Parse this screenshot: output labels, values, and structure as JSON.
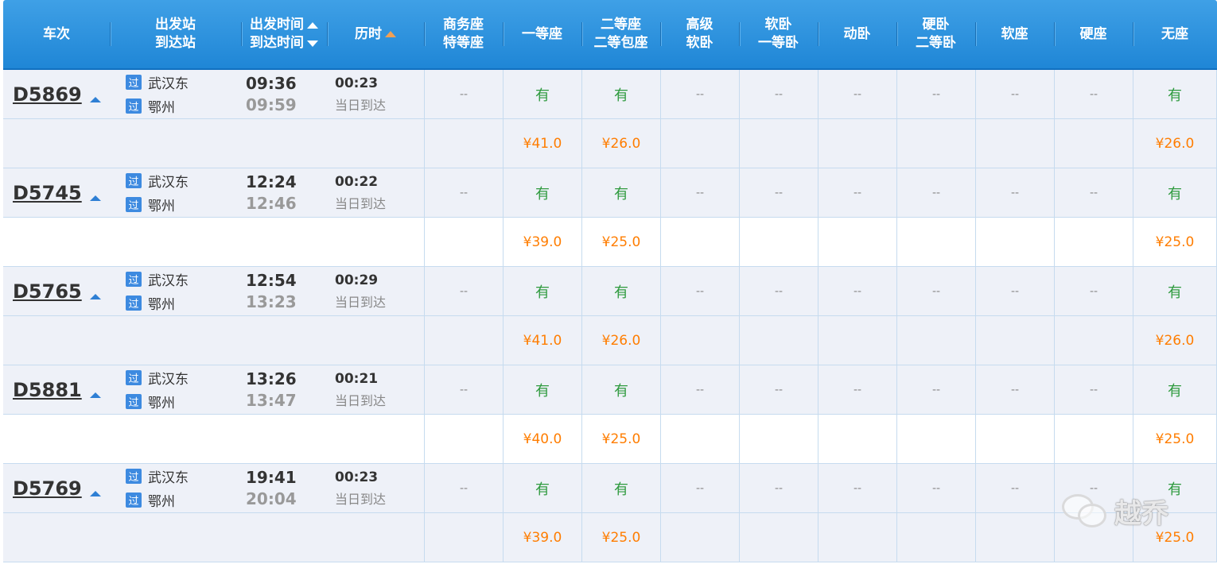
{
  "header": {
    "col_train": "车次",
    "col_from": "出发站",
    "col_to": "到达站",
    "col_dep_time": "出发时间",
    "col_arr_time": "到达时间",
    "col_duration": "历时",
    "col_business_1": "商务座",
    "col_business_2": "特等座",
    "col_first": "一等座",
    "col_second_1": "二等座",
    "col_second_2": "二等包座",
    "col_hsoft_1": "高级",
    "col_hsoft_2": "软卧",
    "col_soft_sleeper_1": "软卧",
    "col_soft_sleeper_2": "一等卧",
    "col_moving_sleeper": "动卧",
    "col_hard_sleeper_1": "硬卧",
    "col_hard_sleeper_2": "二等卧",
    "col_soft_seat": "软座",
    "col_hard_seat": "硬座",
    "col_no_seat": "无座"
  },
  "trains": [
    {
      "code": "D5869",
      "via_badge": "过",
      "from": "武汉东",
      "to": "鄂州",
      "dep": "09:36",
      "arr": "09:59",
      "duration": "00:23",
      "arrive_note": "当日到达",
      "seats": [
        "--",
        "有",
        "有",
        "--",
        "--",
        "--",
        "--",
        "--",
        "--",
        "有"
      ],
      "prices": [
        "",
        "¥41.0",
        "¥26.0",
        "",
        "",
        "",
        "",
        "",
        "",
        "¥26.0"
      ]
    },
    {
      "code": "D5745",
      "via_badge": "过",
      "from": "武汉东",
      "to": "鄂州",
      "dep": "12:24",
      "arr": "12:46",
      "duration": "00:22",
      "arrive_note": "当日到达",
      "seats": [
        "--",
        "有",
        "有",
        "--",
        "--",
        "--",
        "--",
        "--",
        "--",
        "有"
      ],
      "prices": [
        "",
        "¥39.0",
        "¥25.0",
        "",
        "",
        "",
        "",
        "",
        "",
        "¥25.0"
      ]
    },
    {
      "code": "D5765",
      "via_badge": "过",
      "from": "武汉东",
      "to": "鄂州",
      "dep": "12:54",
      "arr": "13:23",
      "duration": "00:29",
      "arrive_note": "当日到达",
      "seats": [
        "--",
        "有",
        "有",
        "--",
        "--",
        "--",
        "--",
        "--",
        "--",
        "有"
      ],
      "prices": [
        "",
        "¥41.0",
        "¥26.0",
        "",
        "",
        "",
        "",
        "",
        "",
        "¥26.0"
      ]
    },
    {
      "code": "D5881",
      "via_badge": "过",
      "from": "武汉东",
      "to": "鄂州",
      "dep": "13:26",
      "arr": "13:47",
      "duration": "00:21",
      "arrive_note": "当日到达",
      "seats": [
        "--",
        "有",
        "有",
        "--",
        "--",
        "--",
        "--",
        "--",
        "--",
        "有"
      ],
      "prices": [
        "",
        "¥40.0",
        "¥25.0",
        "",
        "",
        "",
        "",
        "",
        "",
        "¥25.0"
      ]
    },
    {
      "code": "D5769",
      "via_badge": "过",
      "from": "武汉东",
      "to": "鄂州",
      "dep": "19:41",
      "arr": "20:04",
      "duration": "00:23",
      "arrive_note": "当日到达",
      "seats": [
        "--",
        "有",
        "有",
        "--",
        "--",
        "--",
        "--",
        "--",
        "--",
        "有"
      ],
      "prices": [
        "",
        "¥39.0",
        "¥25.0",
        "",
        "",
        "",
        "",
        "",
        "",
        "¥25.0"
      ]
    }
  ],
  "watermark": {
    "text": "越乔",
    "icon": "wechat-icon"
  },
  "colors": {
    "header": "#1f86d6",
    "available": "#2e9a3e",
    "price": "#ff7d00",
    "row_shade": "#eef1f8"
  }
}
